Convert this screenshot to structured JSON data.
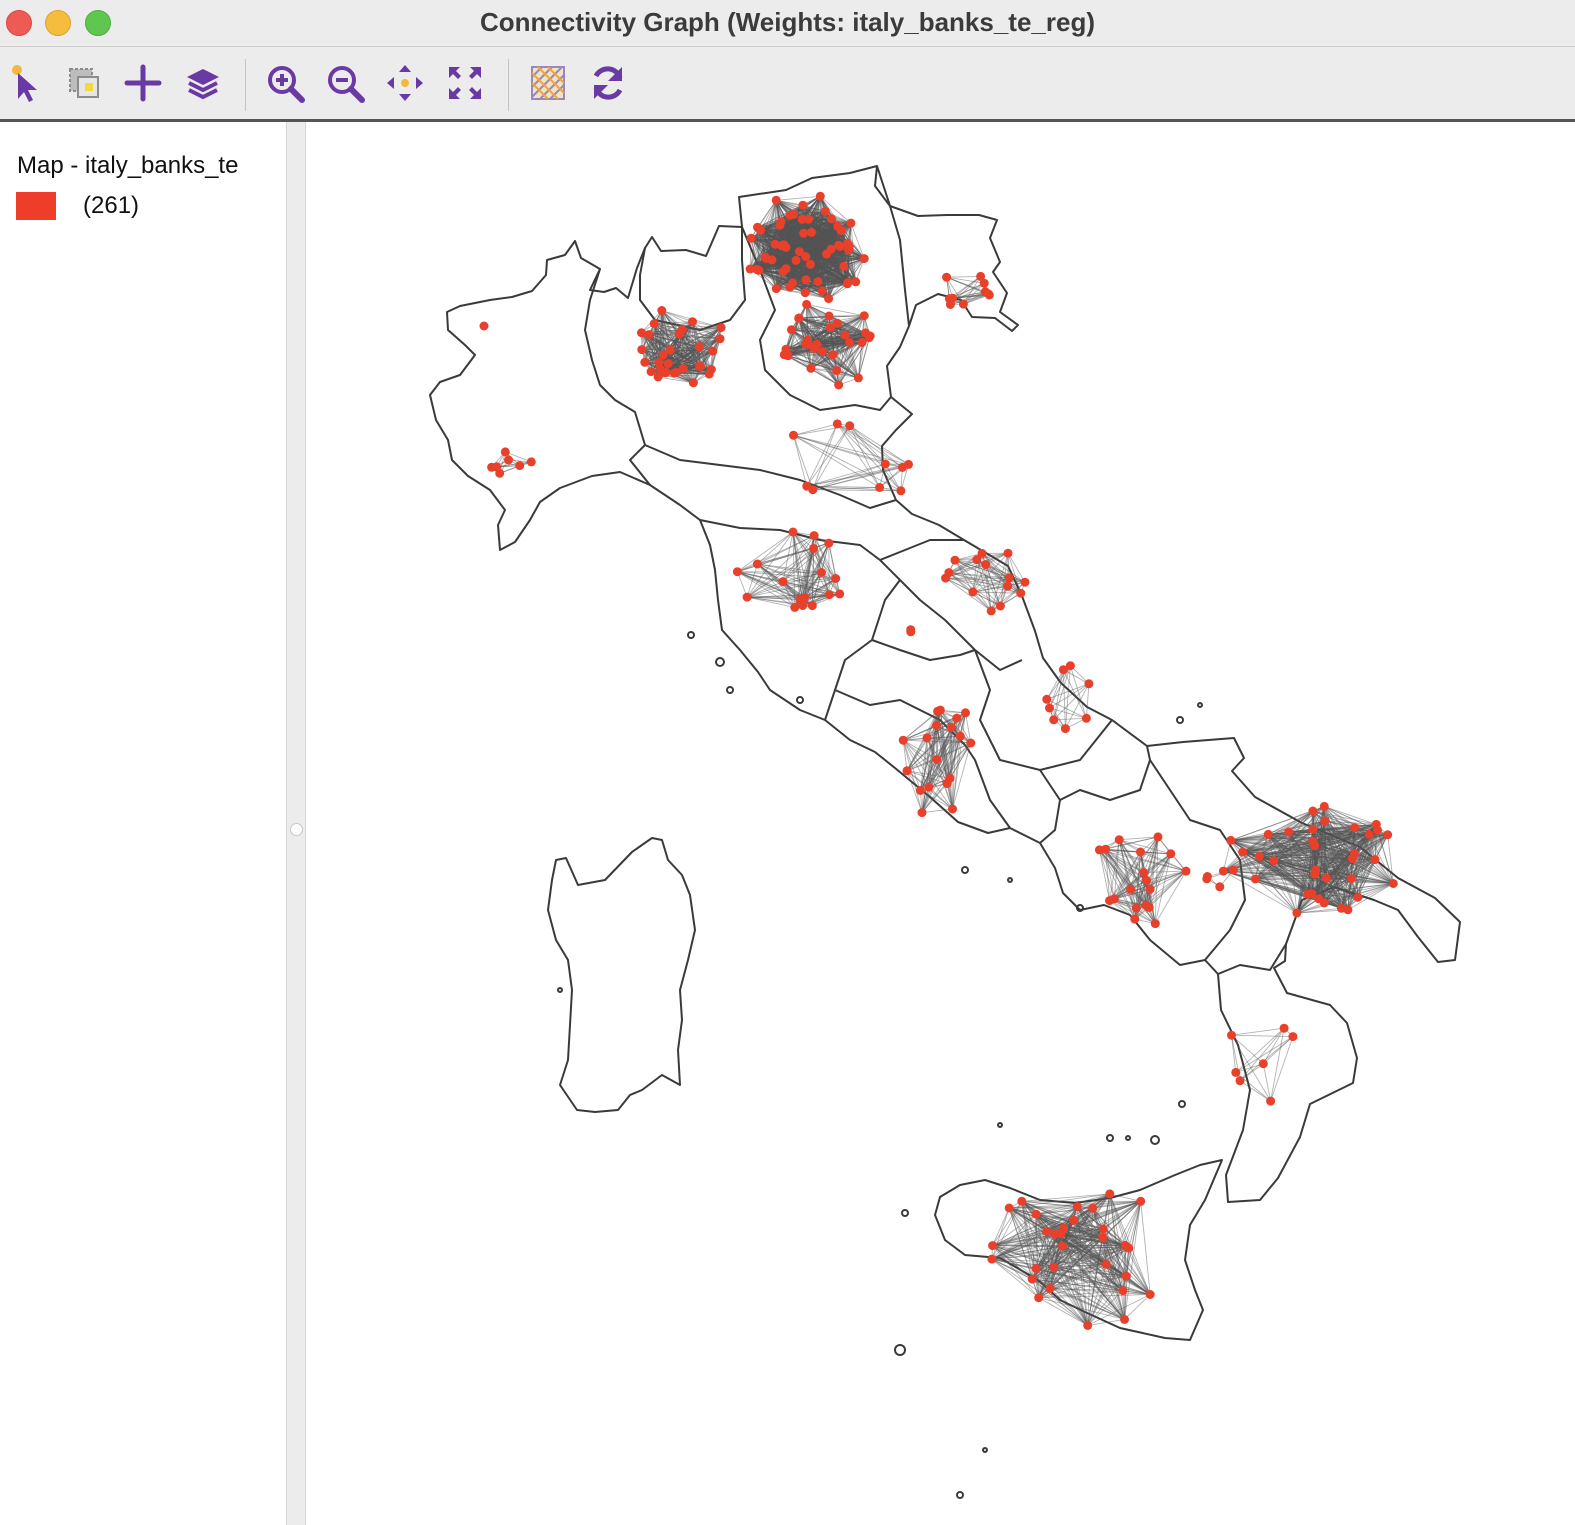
{
  "window": {
    "title": "Connectivity Graph (Weights: italy_banks_te_reg)"
  },
  "toolbar": {
    "tools": [
      {
        "name": "select-tool",
        "icon": "pointer-icon"
      },
      {
        "name": "selection-shape-tool",
        "icon": "select-shape-icon"
      },
      {
        "name": "add-tool",
        "icon": "plus-icon"
      },
      {
        "name": "layers-tool",
        "icon": "layers-icon"
      },
      {
        "name": "zoom-in-tool",
        "icon": "zoom-in-icon"
      },
      {
        "name": "zoom-out-tool",
        "icon": "zoom-out-icon"
      },
      {
        "name": "pan-tool",
        "icon": "pan-icon"
      },
      {
        "name": "fit-extent-tool",
        "icon": "full-extent-icon"
      },
      {
        "name": "basemap-tool",
        "icon": "basemap-icon"
      },
      {
        "name": "refresh-tool",
        "icon": "refresh-icon"
      }
    ]
  },
  "legend": {
    "title": "Map - italy_banks_te",
    "count": "(261)",
    "swatch_color": "#ee3e2a"
  },
  "map": {
    "point_color": "#e8402a",
    "edge_color": "#555555",
    "outline_color": "#3a3a3a"
  }
}
